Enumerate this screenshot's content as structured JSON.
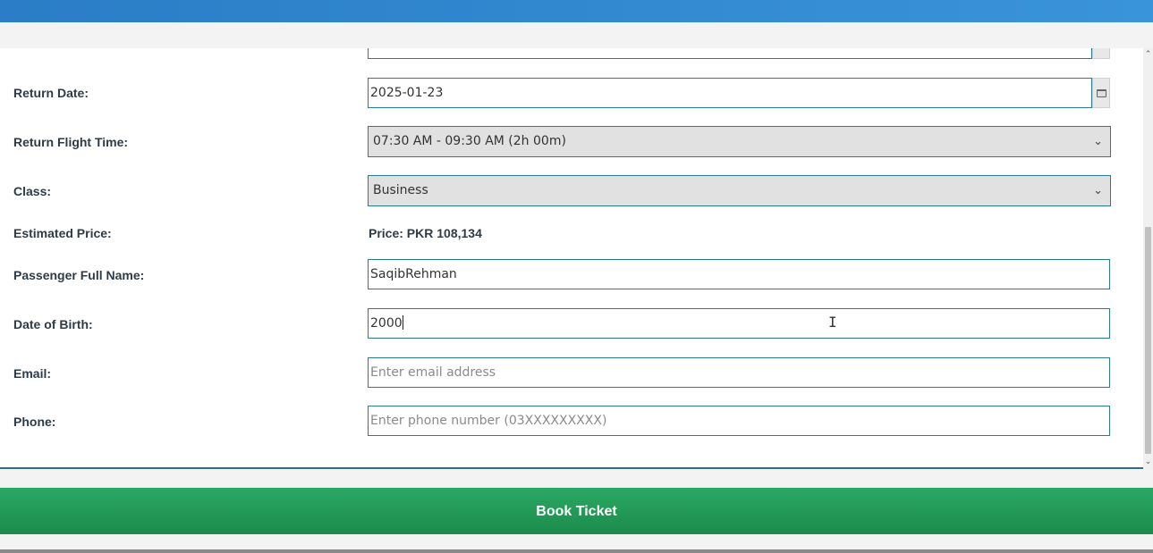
{
  "form": {
    "return_date_label": "Return Date:",
    "return_date_value": "2025-01-23",
    "return_flight_time_label": "Return Flight Time:",
    "return_flight_time_value": "07:30 AM - 09:30 AM (2h 00m)",
    "class_label": "Class:",
    "class_value": "Business",
    "estimated_price_label": "Estimated Price:",
    "estimated_price_value": "Price: PKR 108,134",
    "passenger_name_label": "Passenger Full Name:",
    "passenger_name_value": "SaqibRehman",
    "dob_label": "Date of Birth:",
    "dob_value": "2000",
    "email_label": "Email:",
    "email_placeholder": "Enter email address",
    "phone_label": "Phone:",
    "phone_placeholder": "Enter phone number (03XXXXXXXXX)"
  },
  "actions": {
    "book_label": "Book Ticket"
  },
  "icons": {
    "calendar": "calendar-icon",
    "chevron": "chevron-down-icon"
  },
  "colors": {
    "accent_border": "#2a7a90",
    "book_button": "#1f9555",
    "top_bar": "#2a7dc6"
  }
}
